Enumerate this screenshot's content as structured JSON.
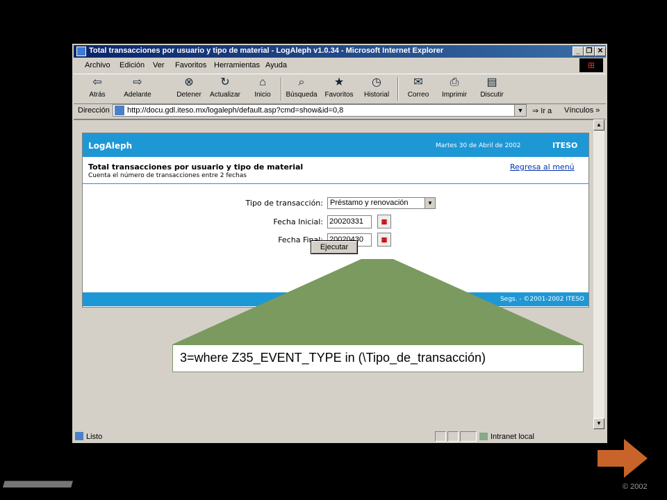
{
  "window": {
    "title": "Total transacciones por usuario y tipo de material - LogAleph v1.0.34 - Microsoft Internet Explorer",
    "controls": [
      "_",
      "❐",
      "✕"
    ]
  },
  "menu": [
    "Archivo",
    "Edición",
    "Ver",
    "Favoritos",
    "Herramientas",
    "Ayuda"
  ],
  "toolbar": {
    "back": "Atrás",
    "forward": "Adelante",
    "stop": "Detener",
    "refresh": "Actualizar",
    "home": "Inicio",
    "search": "Búsqueda",
    "favorites": "Favoritos",
    "history": "Historial",
    "mail": "Correo",
    "print": "Imprimir",
    "discuss": "Discutir"
  },
  "address": {
    "label": "Dirección",
    "url": "http://docu.gdl.iteso.mx/logaleph/default.asp?cmd=show&id=0,8",
    "go": "Ir a",
    "links": "Vínculos »"
  },
  "page": {
    "brand": "LogAleph",
    "date": "Martes 30 de Abril de 2002",
    "org": "ITESO",
    "title": "Total transacciones por usuario y tipo de material",
    "subtitle": "Cuenta el número de transacciones entre 2 fechas",
    "back_link": "Regresa al menú",
    "form": {
      "type_label": "Tipo de transacción:",
      "type_value": "Préstamo y renovación",
      "start_label": "Fecha Inicial:",
      "start_value": "20020331",
      "end_label": "Fecha Final:",
      "end_value": "20020430",
      "run": "Ejecutar"
    },
    "footer": "Segs. - ©2001-2002 ITESO"
  },
  "status": {
    "text": "Listo",
    "zone": "Intranet local"
  },
  "callout": {
    "text": "3=where Z35_EVENT_TYPE in (\\Tipo_de_transacción)",
    "fill": "#7a9a60"
  },
  "slide": {
    "copyright": "©  2002",
    "stripes": "////////////////////////////////////////////////////////////////////////////////////////////////////////////////////////////////////////////////////////////////",
    "arrow_color": "#c8642a"
  }
}
